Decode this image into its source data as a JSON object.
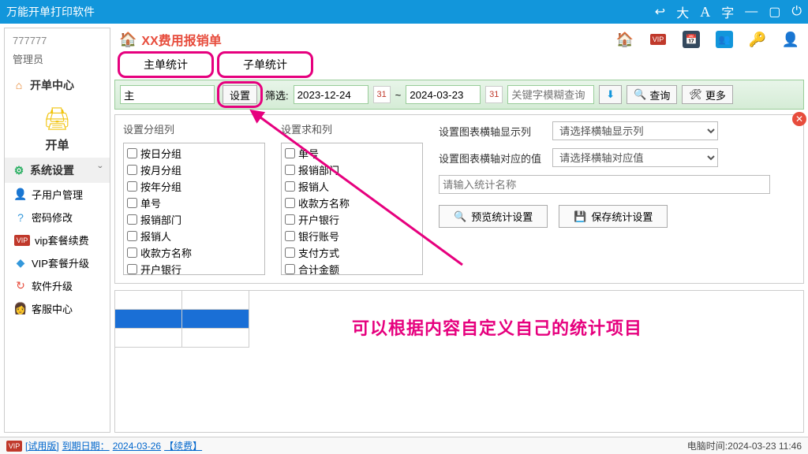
{
  "titlebar": {
    "title": "万能开单打印软件",
    "btn_large": "大",
    "btn_font": "字"
  },
  "sidebar": {
    "user_id": "777777",
    "role": "管理员",
    "center": "开单中心",
    "kaidan": "开单",
    "system": "系统设置",
    "subs": {
      "sub_user": "子用户管理",
      "pwd": "密码修改",
      "vip_renew": "vip套餐续费",
      "vip_upgrade": "VIP套餐升级",
      "soft_upgrade": "软件升级",
      "service": "客服中心"
    }
  },
  "doc_title": "XX费用报销单",
  "tabs": {
    "main": "主单统计",
    "sub": "子单统计"
  },
  "filter": {
    "left_val": "主",
    "setting": "设置",
    "filter_label": "筛选:",
    "date_from": "2023-12-24",
    "date_to": "2024-03-23",
    "sep": "~",
    "cal": "31",
    "keyword_ph": "关键字模糊查询",
    "query": "查询",
    "more": "更多"
  },
  "panel": {
    "group_title": "设置分组列",
    "sum_title": "设置求和列",
    "group_items": [
      "按日分组",
      "按月分组",
      "按年分组",
      "单号",
      "报销部门",
      "报销人",
      "收款方名称",
      "开户银行"
    ],
    "sum_items": [
      "单号",
      "报销部门",
      "报销人",
      "收款方名称",
      "开户银行",
      "银行账号",
      "支付方式",
      "合计金额"
    ],
    "xaxis_label": "设置图表横轴显示列",
    "xaxis_ph": "请选择横轴显示列",
    "xval_label": "设置图表横轴对应的值",
    "xval_ph": "请选择横轴对应值",
    "name_ph": "请输入统计名称",
    "preview": "预览统计设置",
    "save": "保存统计设置"
  },
  "annotation": "可以根据内容自定义自己的统计项目",
  "status": {
    "trial": "[试用版]",
    "expire_label": "到期日期：",
    "expire_date": "2024-03-26",
    "renew": "【续费】",
    "clock_label": "电脑时间:",
    "clock": "2024-03-23 11:46"
  }
}
